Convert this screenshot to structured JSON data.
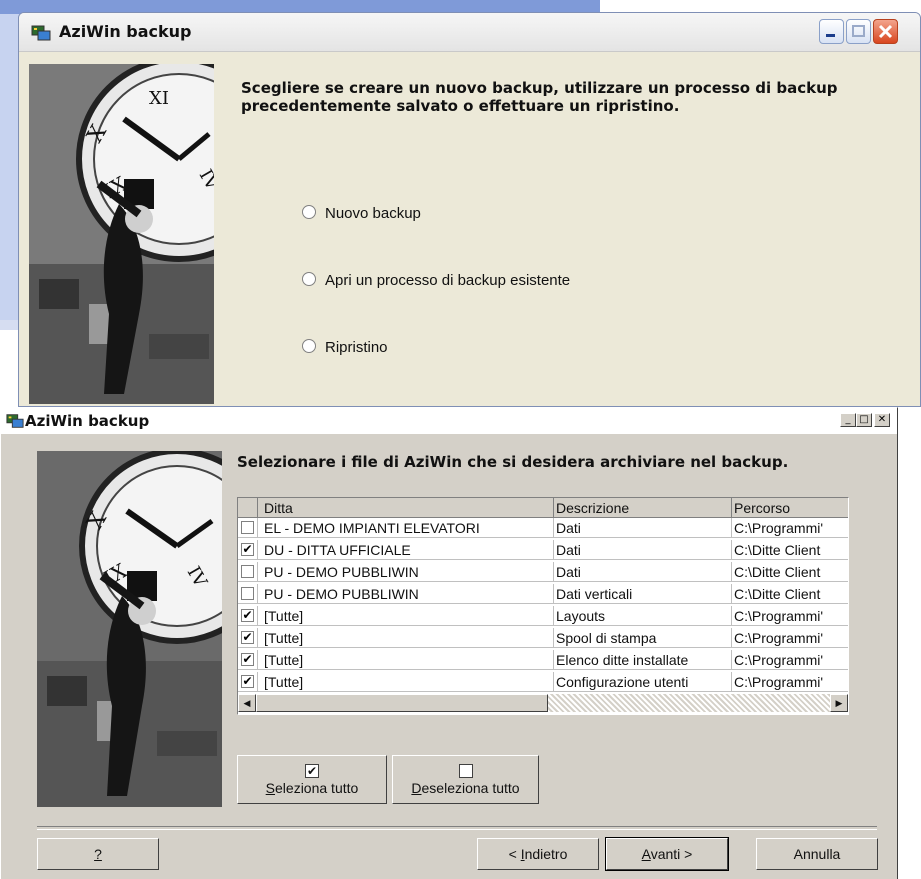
{
  "window1": {
    "title": "AziWin backup",
    "heading": "Scegliere se creare un nuovo backup, utilizzare un processo di backup precedentemente salvato o effettuare un ripristino.",
    "options": [
      "Nuovo backup",
      "Apri un processo di backup esistente",
      "Ripristino"
    ]
  },
  "window2": {
    "title": "AziWin backup",
    "heading": "Selezionare i file di AziWin che si desidera archiviare nel backup.",
    "columns": [
      "Ditta",
      "Descrizione",
      "Percorso"
    ],
    "rows": [
      {
        "checked": false,
        "ditta": "EL - DEMO IMPIANTI ELEVATORI",
        "descrizione": "Dati",
        "percorso": "C:\\Programmi'"
      },
      {
        "checked": true,
        "ditta": "DU - DITTA UFFICIALE",
        "descrizione": "Dati",
        "percorso": "C:\\Ditte Client"
      },
      {
        "checked": false,
        "ditta": "PU - DEMO PUBBLIWIN",
        "descrizione": "Dati",
        "percorso": "C:\\Ditte Client"
      },
      {
        "checked": false,
        "ditta": "PU - DEMO PUBBLIWIN",
        "descrizione": "Dati verticali",
        "percorso": "C:\\Ditte Client"
      },
      {
        "checked": true,
        "ditta": "[Tutte]",
        "descrizione": "Layouts",
        "percorso": "C:\\Programmi'"
      },
      {
        "checked": true,
        "ditta": "[Tutte]",
        "descrizione": "Spool di stampa",
        "percorso": "C:\\Programmi'"
      },
      {
        "checked": true,
        "ditta": "[Tutte]",
        "descrizione": "Elenco ditte installate",
        "percorso": "C:\\Programmi'"
      },
      {
        "checked": true,
        "ditta": "[Tutte]",
        "descrizione": "Configurazione utenti",
        "percorso": "C:\\Programmi'"
      }
    ],
    "select_all": {
      "mnemonic": "S",
      "rest": "eleziona tutto"
    },
    "deselect_all": {
      "mnemonic": "D",
      "rest": "eseleziona tutto"
    },
    "help_label": "?",
    "back": {
      "pre": "< ",
      "mnemonic": "I",
      "rest": "ndietro"
    },
    "next": {
      "mnemonic": "A",
      "rest": "vanti >"
    },
    "cancel_label": "Annulla"
  }
}
